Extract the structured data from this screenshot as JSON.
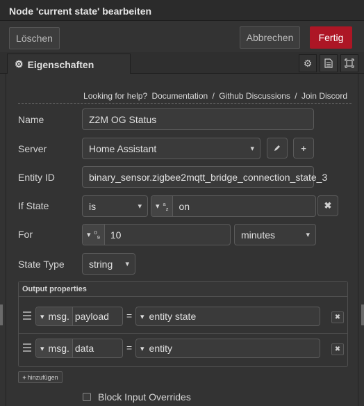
{
  "dialog": {
    "title": "Node 'current state' bearbeiten"
  },
  "actions": {
    "delete": "Löschen",
    "cancel": "Abbrechen",
    "done": "Fertig"
  },
  "tabs": {
    "properties": "Eigenschaften"
  },
  "help": {
    "prefix": "Looking for help?",
    "links": [
      "Documentation",
      "/",
      "Github Discussions",
      "/",
      "Join Discord"
    ]
  },
  "form": {
    "name": {
      "label": "Name",
      "value": "Z2M OG Status"
    },
    "server": {
      "label": "Server",
      "value": "Home Assistant"
    },
    "entity_id": {
      "label": "Entity ID",
      "value": "binary_sensor.zigbee2mqtt_bridge_connection_state_3"
    },
    "if_state": {
      "label": "If State",
      "operator": "is",
      "type_glyph": "a-z",
      "value": "on"
    },
    "for": {
      "label": "For",
      "type_glyph": "0-9",
      "value": "10",
      "unit": "minutes"
    },
    "state_type": {
      "label": "State Type",
      "value": "string"
    }
  },
  "output": {
    "title": "Output properties",
    "rows": [
      {
        "prefix": "msg.",
        "property": "payload",
        "eq": "=",
        "value": "entity state"
      },
      {
        "prefix": "msg.",
        "property": "data",
        "eq": "=",
        "value": "entity"
      }
    ],
    "add": "hinzufügen"
  },
  "block_input": {
    "label": "Block Input Overrides",
    "checked": false
  },
  "colors": {
    "primary": "#ad1625",
    "background": "#333333"
  }
}
